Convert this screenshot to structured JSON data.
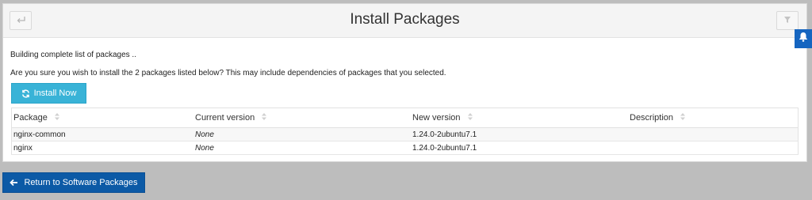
{
  "header": {
    "title": "Install Packages",
    "back_icon": "arrow-back-icon",
    "filter_icon": "filter-icon"
  },
  "messages": {
    "status": "Building complete list of packages ..",
    "confirm": "Are you sure you wish to install the 2 packages listed below? This may include dependencies of packages that you selected."
  },
  "install_button": {
    "label": "Install Now",
    "icon": "refresh-icon",
    "color": "#39b3d7"
  },
  "table": {
    "columns": [
      "Package",
      "Current version",
      "New version",
      "Description"
    ],
    "rows": [
      {
        "package": "nginx-common",
        "current": "None",
        "new": "1.24.0-2ubuntu7.1",
        "description": ""
      },
      {
        "package": "nginx",
        "current": "None",
        "new": "1.24.0-2ubuntu7.1",
        "description": ""
      }
    ]
  },
  "return_button": {
    "label": "Return to Software Packages",
    "icon": "arrow-left-icon",
    "color": "#0c5aa6"
  },
  "notifications": {
    "icon": "bell-icon",
    "color": "#1565c0"
  }
}
